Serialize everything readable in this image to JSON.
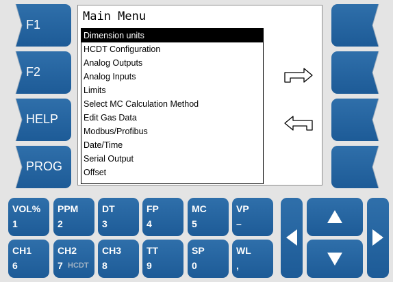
{
  "soft_keys_left": [
    {
      "label": "F1"
    },
    {
      "label": "F2"
    },
    {
      "label": "HELP"
    },
    {
      "label": "PROG"
    }
  ],
  "screen": {
    "title": "Main Menu",
    "menu_items": [
      "Dimension units",
      "HCDT Configuration",
      "Analog Outputs",
      "Analog Inputs",
      "Limits",
      "Select MC Calculation Method",
      "Edit Gas Data",
      "Modbus/Profibus",
      "Date/Time",
      "Serial Output",
      "Offset"
    ],
    "selected_index": 0
  },
  "keypad": {
    "row1": [
      {
        "top": "VOL%",
        "bottom": "1"
      },
      {
        "top": "PPM",
        "bottom": "2"
      },
      {
        "top": "DT",
        "bottom": "3"
      },
      {
        "top": "FP",
        "bottom": "4"
      },
      {
        "top": "MC",
        "bottom": "5"
      },
      {
        "top": "VP",
        "bottom": "–"
      }
    ],
    "row2": [
      {
        "top": "CH1",
        "bottom": "6"
      },
      {
        "top": "CH2",
        "bottom": "7",
        "extra": "HCDT"
      },
      {
        "top": "CH3",
        "bottom": "8"
      },
      {
        "top": "TT",
        "bottom": "9"
      },
      {
        "top": "SP",
        "bottom": "0"
      },
      {
        "top": "WL",
        "bottom": ","
      }
    ]
  },
  "colors": {
    "key_blue": "#1d5b97",
    "background": "#e4e4e4",
    "selection": "#000000"
  }
}
